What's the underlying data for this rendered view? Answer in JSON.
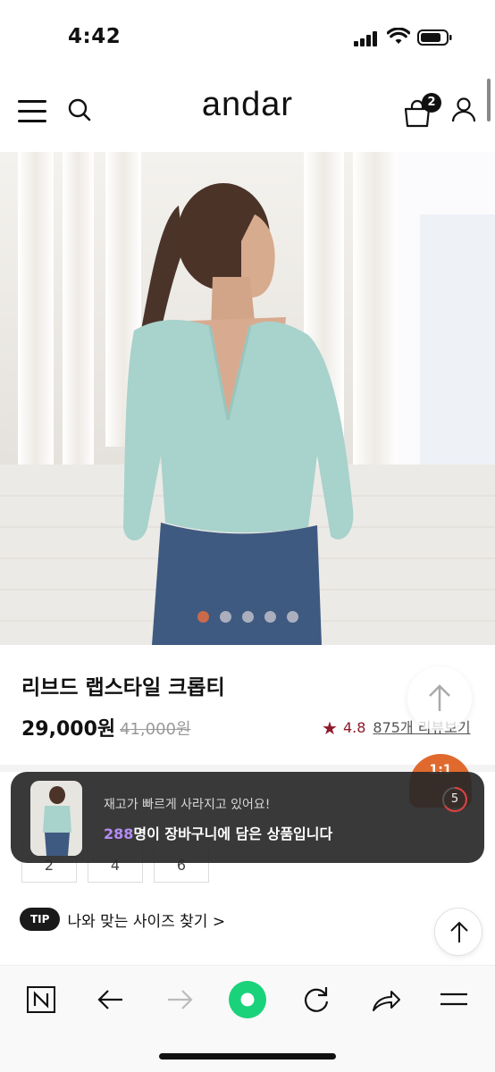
{
  "status_bar": {
    "time": "4:42"
  },
  "header": {
    "logo": "andar",
    "cart_count": "2"
  },
  "carousel": {
    "total": 5,
    "active_index": 0
  },
  "product": {
    "name": "리브드 랩스타일 크롭티",
    "price": "29,000원",
    "original_price": "41,000원",
    "rating": "4.8",
    "reviews_link": "875개 리뷰보기"
  },
  "sizes": [
    "2",
    "4",
    "6"
  ],
  "toast": {
    "line1": "재고가 빠르게 사라지고 있어요!",
    "count": "288",
    "line2_suffix": "명이 장바구니에 담은 상품입니다",
    "timer": "5"
  },
  "chat_badge": "1:1",
  "tip": {
    "badge": "TIP",
    "text": "나와 맞는 사이즈 찾기 >"
  },
  "colors": {
    "accent_star": "#8e1a2a",
    "count_purple": "#b58cf4",
    "active_dot": "#c96a4a",
    "chat_orange": "#e06a2e",
    "record_green": "#19d27a"
  },
  "bottom_bar": [
    "n-logo-icon",
    "back-arrow-icon",
    "forward-arrow-icon",
    "record-icon",
    "reload-icon",
    "share-icon",
    "menu-icon"
  ]
}
